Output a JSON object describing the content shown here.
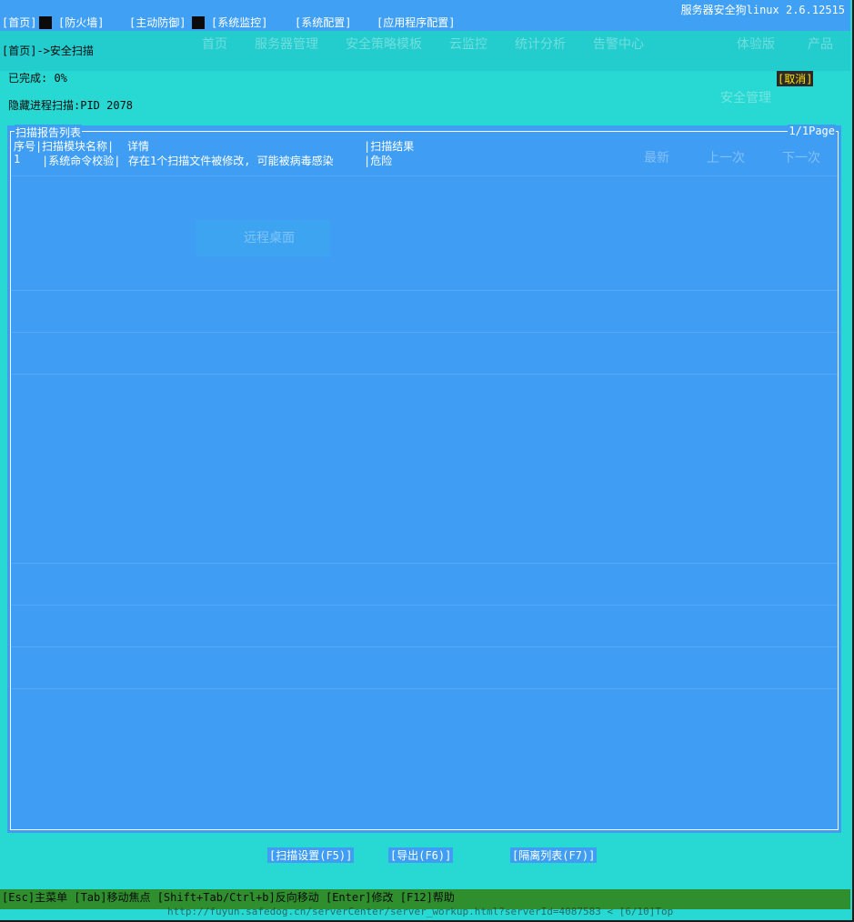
{
  "menu": {
    "items": [
      "[首页]",
      "[防火墙]",
      "[主动防御]",
      "[系统监控]",
      "[系统配置]",
      "[应用程序配置]"
    ],
    "version": "服务器安全狗linux 2.6.12515"
  },
  "overlay_nav": [
    "首页",
    "服务器管理",
    "安全策略模板",
    "云监控",
    "统计分析",
    "告警中心",
    "体验版",
    "产品"
  ],
  "breadcrumb": "[首页]->安全扫描",
  "progress": {
    "label": "已完成:  0%",
    "percent": 0
  },
  "cancel_label": "[取消]",
  "hidden_process": "隐藏进程扫描:PID 2078",
  "overlay_misc": {
    "security_mgmt": "安全管理",
    "remote_desktop": "远程桌面",
    "latest": "最新",
    "prev": "上一次",
    "next": "下一次"
  },
  "report": {
    "title": "扫描报告列表",
    "page": "1/1Page",
    "headers": [
      "序号|",
      "扫描模块名称|",
      "详情",
      "|扫描结果"
    ],
    "rows": [
      {
        "no": "1",
        "module": "|系统命令校验|",
        "detail": "存在1个扫描文件被修改, 可能被病毒感染",
        "result": "|危险"
      }
    ]
  },
  "actions": {
    "scan_settings": "[扫描设置(F5)]",
    "export": "[导出(F6)]",
    "quarantine": "[隔离列表(F7)]"
  },
  "status": {
    "help": "[Esc]主菜单 [Tab]移动焦点 [Shift+Tab/Ctrl+b]反向移动 [Enter]修改 [F12]帮助",
    "url": "http://fuyun.safedog.cn/serverCenter/server_workup.html?serverId=4087583 < [6/10]Top"
  }
}
